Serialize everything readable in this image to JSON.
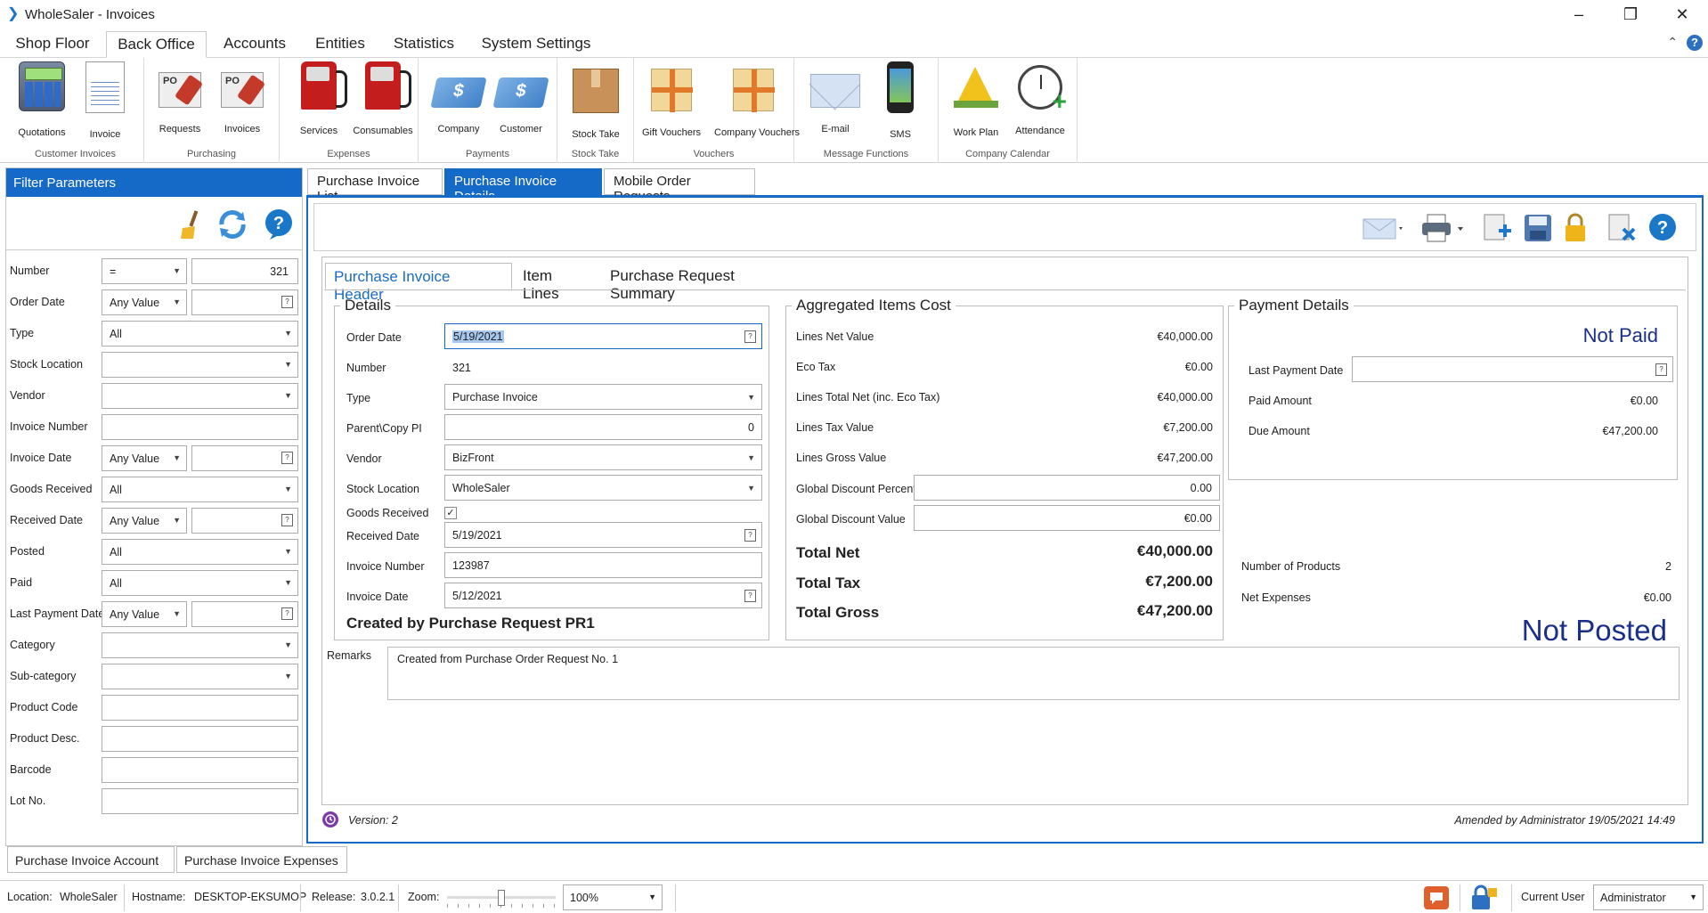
{
  "window": {
    "title": "WholeSaler - Invoices",
    "minimize": "–",
    "restore": "❐",
    "close": "✕"
  },
  "ribbon_tabs": [
    "Shop Floor",
    "Back Office",
    "Accounts",
    "Entities",
    "Statistics",
    "System Settings"
  ],
  "ribbon_ctrl": {
    "collapse": "⌃",
    "help": "?"
  },
  "ribbon": {
    "groups": [
      {
        "title": "Customer Invoices",
        "items": [
          "Quotations",
          "Invoice"
        ]
      },
      {
        "title": "Purchasing",
        "items": [
          "Requests",
          "Invoices"
        ],
        "po": "PO"
      },
      {
        "title": "Expenses",
        "items": [
          "Services",
          "Consumables"
        ]
      },
      {
        "title": "Payments",
        "items": [
          "Company",
          "Customer"
        ]
      },
      {
        "title": "Stock Take",
        "items": [
          "Stock Take"
        ]
      },
      {
        "title": "Vouchers",
        "items": [
          "Gift Vouchers",
          "Company Vouchers"
        ]
      },
      {
        "title": "Message Functions",
        "items": [
          "E-mail",
          "SMS"
        ]
      },
      {
        "title": "Company Calendar",
        "items": [
          "Work Plan",
          "Attendance"
        ]
      }
    ]
  },
  "filter": {
    "title": "Filter Parameters",
    "rows": [
      {
        "label": "Number",
        "op": "=",
        "value": "321"
      },
      {
        "label": "Order Date",
        "op": "Any Value",
        "value": ""
      },
      {
        "label": "Type",
        "value": "All"
      },
      {
        "label": "Stock Location",
        "value": ""
      },
      {
        "label": "Vendor",
        "value": ""
      },
      {
        "label": "Invoice Number",
        "value": ""
      },
      {
        "label": "Invoice Date",
        "op": "Any Value",
        "value": ""
      },
      {
        "label": "Goods Received",
        "value": "All"
      },
      {
        "label": "Received Date",
        "op": "Any Value",
        "value": ""
      },
      {
        "label": "Posted",
        "value": "All"
      },
      {
        "label": "Paid",
        "value": "All"
      },
      {
        "label": "Last Payment Date",
        "op": "Any Value",
        "value": ""
      },
      {
        "label": "Category",
        "value": ""
      },
      {
        "label": "Sub-category",
        "value": ""
      },
      {
        "label": "Product Code",
        "value": ""
      },
      {
        "label": "Product Desc.",
        "value": ""
      },
      {
        "label": "Barcode",
        "value": ""
      },
      {
        "label": "Lot No.",
        "value": ""
      }
    ]
  },
  "bottom_tabs": [
    "Purchase Invoice Account",
    "Purchase Invoice Expenses"
  ],
  "main_tabs": [
    "Purchase Invoice List",
    "Purchase Invoice Details",
    "Mobile Order Requests"
  ],
  "inner_tabs": [
    "Purchase Invoice Header",
    "Item Lines",
    "Purchase Request Summary"
  ],
  "details": {
    "legend": "Details",
    "order_date_label": "Order Date",
    "order_date": "5/19/2021",
    "number_label": "Number",
    "number": "321",
    "type_label": "Type",
    "type": "Purchase Invoice",
    "parent_label": "Parent\\Copy PI",
    "parent": "0",
    "vendor_label": "Vendor",
    "vendor": "BizFront",
    "stock_label": "Stock Location",
    "stock": "WholeSaler",
    "goods_label": "Goods Received",
    "goods_check": "✓",
    "received_label": "Received Date",
    "received": "5/19/2021",
    "invno_label": "Invoice Number",
    "invno": "123987",
    "invdate_label": "Invoice Date",
    "invdate": "5/12/2021",
    "created_by": "Created by Purchase Request PR1"
  },
  "aggregated": {
    "legend": "Aggregated Items Cost",
    "rows": [
      {
        "label": "Lines Net Value",
        "value": "€40,000.00"
      },
      {
        "label": "Eco Tax",
        "value": "€0.00"
      },
      {
        "label": "Lines Total Net (inc. Eco Tax)",
        "value": "€40,000.00"
      },
      {
        "label": "Lines Tax Value",
        "value": "€7,200.00"
      },
      {
        "label": "Lines Gross Value",
        "value": "€47,200.00"
      }
    ],
    "disc_pct_label": "Global Discount Percent",
    "disc_pct": "0.00",
    "disc_val_label": "Global Discount Value",
    "disc_val": "€0.00",
    "total_net_label": "Total Net",
    "total_net": "€40,000.00",
    "total_tax_label": "Total Tax",
    "total_tax": "€7,200.00",
    "total_gross_label": "Total Gross",
    "total_gross": "€47,200.00"
  },
  "payment": {
    "legend": "Payment Details",
    "status": "Not Paid",
    "last_label": "Last Payment Date",
    "last": "",
    "paid_label": "Paid Amount",
    "paid": "€0.00",
    "due_label": "Due Amount",
    "due": "€47,200.00"
  },
  "summary": {
    "products_label": "Number of Products",
    "products": "2",
    "expenses_label": "Net Expenses",
    "expenses": "€0.00",
    "posted": "Not Posted"
  },
  "remarks": {
    "label": "Remarks",
    "text": "Created from Purchase Order Request No. 1"
  },
  "footer": {
    "version": "Version:  2",
    "amended": "Amended by Administrator 19/05/2021 14:49"
  },
  "status": {
    "location_label": "Location:",
    "location": "WholeSaler",
    "host_label": "Hostname:",
    "host": "DESKTOP-EKSUMOP",
    "release_label": "Release:",
    "release": "3.0.2.1",
    "zoom_label": "Zoom:",
    "zoom": "100%",
    "zoom_slider": 0.5,
    "user_label": "Current User",
    "user": "Administrator"
  },
  "colors": {
    "accent": "#1569c7",
    "status_text": "#1a2f8a"
  }
}
